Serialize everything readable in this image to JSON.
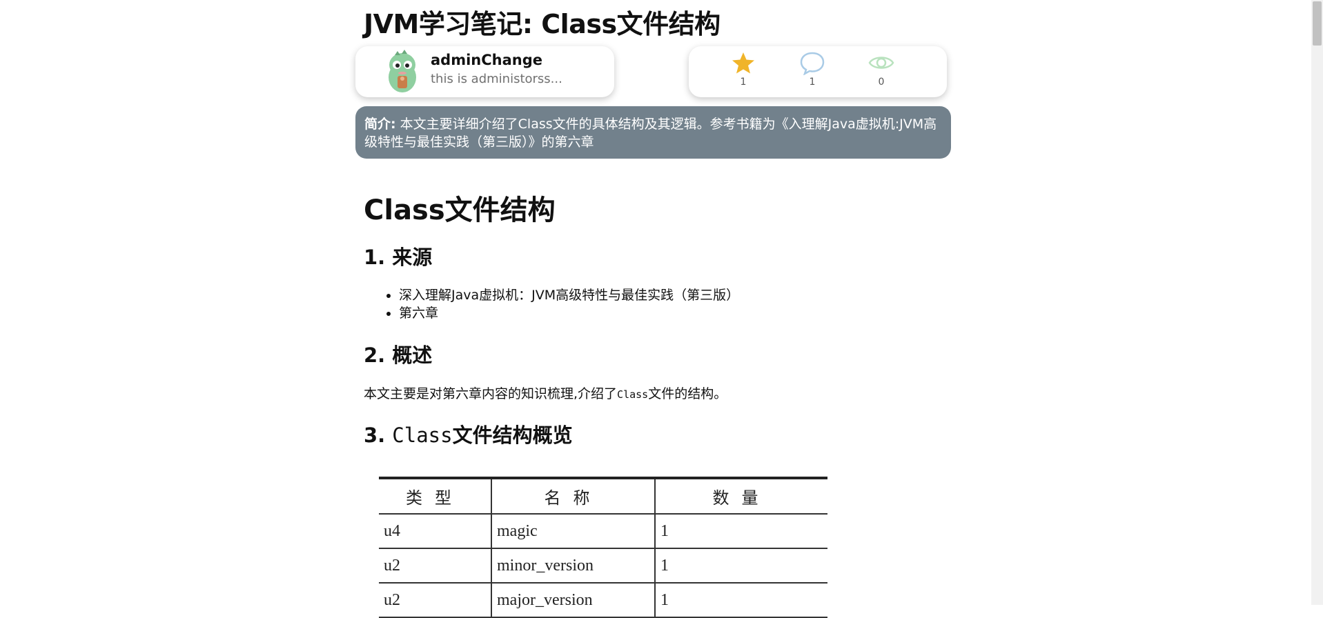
{
  "page": {
    "title": "JVM学习笔记: Class文件结构"
  },
  "author": {
    "name": "adminChange",
    "description": "this is administorss..."
  },
  "stats": {
    "stars": "1",
    "comments": "1",
    "views": "0",
    "colors": {
      "star": "#f0b429",
      "comment": "#a9cbe6",
      "view": "#b9e2be"
    }
  },
  "summary": {
    "label": "简介:",
    "text": "本文主要详细介绍了Class文件的具体结构及其逻辑。参考书籍为《入理解Java虚拟机:JVM高级特性与最佳实践（第三版）》的第六章",
    "background_color": "#72818c"
  },
  "article": {
    "h1": "Class文件结构",
    "section1": {
      "heading": "1. 来源",
      "items": [
        "深入理解Java虚拟机：JVM高级特性与最佳实践（第三版）",
        "第六章"
      ]
    },
    "section2": {
      "heading": "2. 概述",
      "text_before": "本文主要是对第六章内容的知识梳理,介绍了",
      "code": "Class",
      "text_after": "文件的结构。"
    },
    "section3": {
      "heading_prefix": "3. ",
      "heading_code": "Class",
      "heading_suffix": "文件结构概览"
    },
    "table": {
      "headers": [
        "类型",
        "名称",
        "数量"
      ],
      "rows": [
        [
          "u4",
          "magic",
          "1"
        ],
        [
          "u2",
          "minor_version",
          "1"
        ],
        [
          "u2",
          "major_version",
          "1"
        ]
      ]
    }
  }
}
